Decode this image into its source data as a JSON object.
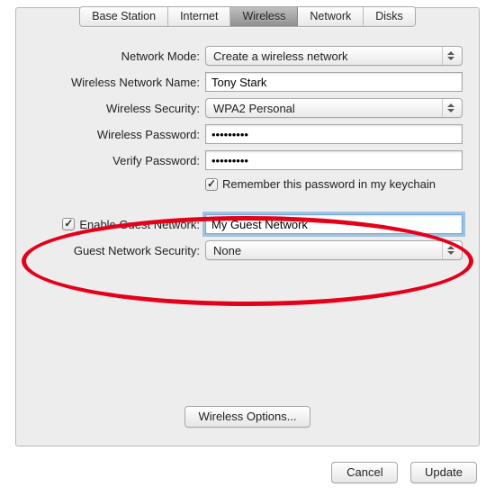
{
  "tabs": {
    "items": [
      {
        "label": "Base Station"
      },
      {
        "label": "Internet"
      },
      {
        "label": "Wireless"
      },
      {
        "label": "Network"
      },
      {
        "label": "Disks"
      }
    ],
    "active_index": 2
  },
  "form": {
    "network_mode": {
      "label": "Network Mode:",
      "value": "Create a wireless network"
    },
    "network_name": {
      "label": "Wireless Network Name:",
      "value": "Tony Stark"
    },
    "security": {
      "label": "Wireless Security:",
      "value": "WPA2 Personal"
    },
    "password": {
      "label": "Wireless Password:",
      "value": "•••••••••"
    },
    "verify": {
      "label": "Verify Password:",
      "value": "•••••••••"
    },
    "remember": {
      "label": "Remember this password in my keychain",
      "checked": true
    },
    "guest_enable": {
      "label": "Enable Guest Network:",
      "value": "My Guest Network",
      "checked": true
    },
    "guest_security": {
      "label": "Guest Network Security:",
      "value": "None"
    }
  },
  "buttons": {
    "wireless_options": "Wireless Options...",
    "cancel": "Cancel",
    "update": "Update"
  }
}
